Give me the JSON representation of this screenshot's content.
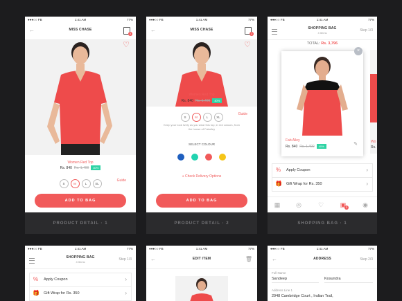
{
  "status": {
    "carrier": "●●●○○ FB",
    "time": "1:41 AM",
    "battery": "77%"
  },
  "s1": {
    "title": "MISS CHASE",
    "bag_count": "3",
    "product_name": "Women Red Top",
    "price": "Rs. 840",
    "old_price": "Rs. 1,400",
    "discount": "40%",
    "sizes": [
      "S",
      "M",
      "L",
      "XL"
    ],
    "selected_size": "M",
    "guide": "Guide",
    "cta": "ADD TO BAG",
    "caption": "PRODUCT DETAIL · 1"
  },
  "s2": {
    "title": "MISS CHASE",
    "bag_count": "3",
    "product_name": "Women Red Top",
    "price": "Rs. 840",
    "old_price": "Rs. 1,400",
    "discount": "40%",
    "sizes": [
      "S",
      "M",
      "L",
      "XL"
    ],
    "guide": "Guide",
    "description": "Keep your look lively as you wear this top, in red colours, from the house of Fabulley",
    "colour_label": "SELECT COLOUR",
    "colours": [
      "#1f5fbf",
      "#22d3b0",
      "#f15a5a",
      "#f5c518"
    ],
    "delivery": "Check Delivery Options",
    "cta": "ADD TO BAG",
    "caption": "PRODUCT DETAIL · 2"
  },
  "s3": {
    "title": "SHOPPING BAG",
    "subtitle": "4 Items",
    "step": "Step 1/3",
    "total_label": "TOTAL:",
    "total_value": "Rs. 3,796",
    "item_name": "Fab Alley",
    "price": "Rs. 840",
    "old_price": "Rs. 1,400",
    "discount": "40%",
    "side_name": "Wo",
    "side_price": "Rs.",
    "coupon": "Apply Coupon",
    "giftwrap": "Gift Wrap for Rs. 350",
    "tab_badge": "3",
    "caption": "SHOPPING BAG · 1"
  },
  "s4": {
    "title": "SHOPPING BAG",
    "subtitle": "4 Items",
    "step": "Step 1/3",
    "coupon": "Apply Coupon",
    "giftwrap": "Gift Wrap for Rs. 350"
  },
  "s5": {
    "title": "EDIT ITEM"
  },
  "s6": {
    "title": "ADDRESS",
    "step": "Step 2/3",
    "fullname_label": "Full Name",
    "first_name": "Sandeep",
    "last_name": "Kosundra",
    "address_label": "Address Line 1",
    "address": "2948 Cambridge Court , Indian Trail,"
  }
}
